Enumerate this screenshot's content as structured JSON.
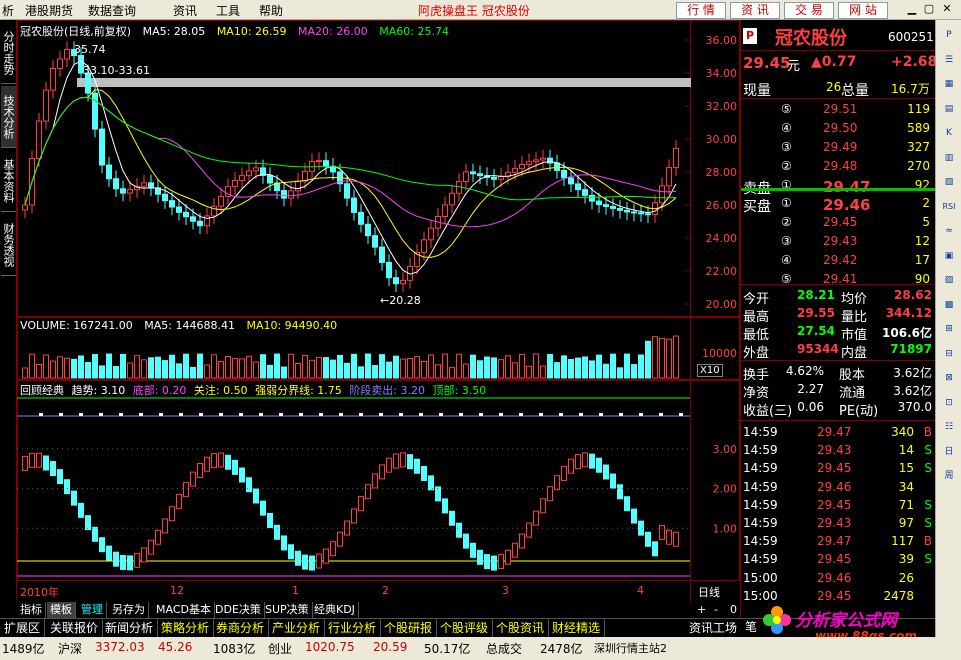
{
  "app": {
    "title": "阿虎操盘王  冠农股份",
    "menu": [
      "析",
      "港股期货",
      "数据查询",
      "资讯",
      "工具",
      "帮助"
    ],
    "menu_ids": [
      "analysis",
      "hk-futures",
      "data-query",
      "news",
      "tools",
      "help"
    ],
    "top_buttons": [
      "行 情",
      "资 讯",
      "交 易",
      "网 站"
    ],
    "top_button_ids": [
      "quotes",
      "news",
      "trade",
      "website"
    ]
  },
  "left_tabs": [
    "分时走势",
    "技术分析",
    "基本资料",
    "财务透视"
  ],
  "left_tab_ids": [
    "intraday",
    "technical",
    "fundamentals",
    "financial"
  ],
  "chart_info": {
    "title": "冠农股份(日线,前复权)",
    "ma5": "MA5: 28.05",
    "ma10": "MA10: 26.59",
    "ma20": "MA20: 26.00",
    "ma60": "MA60: 25.74",
    "hi_label": "35.74",
    "range_label": "33.10-33.61",
    "lo_label": "←20.28",
    "volume": "VOLUME: 167241.00",
    "vma5": "MA5: 144688.41",
    "vma10": "MA10: 94490.40",
    "indicator_name": "回顾经典",
    "trend": "趋势: 3.10",
    "bottom": "底部: 0.20",
    "focus": "关注: 0.50",
    "divide": "强弱分界线: 1.75",
    "stage_sell": "阶段卖出: 3.20",
    "top": "顶部: 3.50",
    "date_left": "2010年",
    "date_ticks": [
      "12",
      "1",
      "2",
      "3",
      "4"
    ],
    "period": "日线",
    "price_ticks": [
      "36.00",
      "34.00",
      "32.00",
      "30.00",
      "28.00",
      "26.00",
      "24.00",
      "22.00",
      "20.00"
    ],
    "vol_tick": "10000",
    "vol_mult": "X10",
    "ind_ticks": [
      "3.00",
      "2.00",
      "1.00"
    ],
    "colors": {
      "up": "#ff4040",
      "down": "#54ffff",
      "ma5": "#ffffff",
      "ma10": "#ffff00",
      "ma20": "#ff40ff",
      "ma60": "#00ff00"
    }
  },
  "bottom_tabs": [
    "指标",
    "模板",
    "管理",
    "另存为",
    "MACD基本",
    "DDE决策",
    "SUP决策",
    "经典KDJ"
  ],
  "bottom_tab_ids": [
    "indicator",
    "template",
    "manage",
    "save-as",
    "macd-basic",
    "dde",
    "sup",
    "classic-kdj"
  ],
  "bottom_tools": [
    "+",
    "-",
    "0"
  ],
  "toolbar2": [
    "扩展区",
    "关联报价",
    "新闻分析",
    "策略分析",
    "券商分析",
    "产业分析",
    "行业分析",
    "个股研报",
    "个股评级",
    "个股资讯",
    "财经精选"
  ],
  "toolbar2_ids": [
    "extension",
    "related-quotes",
    "news-analysis",
    "strategy",
    "broker",
    "industry-chain",
    "sector",
    "research",
    "rating",
    "stock-news",
    "finance-picks"
  ],
  "toolbar2_right": "资讯工场",
  "quote": {
    "name": "冠农股份",
    "code": "600251",
    "price": "29.45",
    "price_unit": "元",
    "change": "▲0.77",
    "change_pct": "+2.68",
    "cur_vol_label": "现量",
    "cur_vol": "26",
    "total_vol_label": "总量",
    "total_vol": "16.7万",
    "sell_label": "卖盘",
    "buy_label": "买盘",
    "sell": [
      {
        "lvl": "⑤",
        "price": "29.51",
        "vol": "119"
      },
      {
        "lvl": "④",
        "price": "29.50",
        "vol": "589"
      },
      {
        "lvl": "③",
        "price": "29.49",
        "vol": "327"
      },
      {
        "lvl": "②",
        "price": "29.48",
        "vol": "270"
      },
      {
        "lvl": "①",
        "price": "29.47",
        "vol": "92"
      }
    ],
    "buy": [
      {
        "lvl": "①",
        "price": "29.46",
        "vol": "2"
      },
      {
        "lvl": "②",
        "price": "29.45",
        "vol": "5"
      },
      {
        "lvl": "③",
        "price": "29.43",
        "vol": "12"
      },
      {
        "lvl": "④",
        "price": "29.42",
        "vol": "17"
      },
      {
        "lvl": "⑤",
        "price": "29.41",
        "vol": "90"
      }
    ],
    "stats": [
      {
        "l1": "今开",
        "v1": "28.21",
        "l2": "均价",
        "v2": "28.62"
      },
      {
        "l1": "最高",
        "v1": "29.55",
        "l2": "量比",
        "v2": "344.12"
      },
      {
        "l1": "最低",
        "v1": "27.54",
        "l2": "市值",
        "v2": "106.6亿"
      },
      {
        "l1": "外盘",
        "v1": "95344",
        "l2": "内盘",
        "v2": "71897"
      }
    ],
    "fundamentals": [
      {
        "l1": "换手",
        "v1": "4.62%",
        "l2": "股本",
        "v2": "3.62亿"
      },
      {
        "l1": "净资",
        "v1": "2.27",
        "l2": "流通",
        "v2": "3.62亿"
      },
      {
        "l1": "收益(三)",
        "v1": "0.06",
        "l2": "PE(动)",
        "v2": "370.0"
      }
    ],
    "ticks": [
      {
        "t": "14:59",
        "p": "29.47",
        "v": "340",
        "d": "B"
      },
      {
        "t": "14:59",
        "p": "29.43",
        "v": "14",
        "d": "S"
      },
      {
        "t": "14:59",
        "p": "29.45",
        "v": "15",
        "d": "S"
      },
      {
        "t": "14:59",
        "p": "29.46",
        "v": "34",
        "d": ""
      },
      {
        "t": "14:59",
        "p": "29.45",
        "v": "71",
        "d": "S"
      },
      {
        "t": "14:59",
        "p": "29.43",
        "v": "97",
        "d": "S"
      },
      {
        "t": "14:59",
        "p": "29.47",
        "v": "117",
        "d": "B"
      },
      {
        "t": "14:59",
        "p": "29.45",
        "v": "39",
        "d": "S"
      },
      {
        "t": "15:00",
        "p": "29.46",
        "v": "26",
        "d": ""
      },
      {
        "t": "15:00",
        "p": "29.45",
        "v": "2478",
        "d": ""
      }
    ],
    "tick_tab": "笔"
  },
  "right_toolbar": [
    "P",
    "☰",
    "▦",
    "▤",
    "K",
    "▥",
    "▧",
    "RSI",
    "≈",
    "▣",
    "▨",
    "▩",
    "⊞",
    "⊟",
    "⊠",
    "⊡",
    "☷",
    "日",
    "周"
  ],
  "statusbar": {
    "item1": "1489亿",
    "sz_label": "沪深",
    "sz_val": "3372.03",
    "sz_chg": "45.26",
    "item2": "1083亿",
    "cy_label": "创业",
    "cy_val": "1020.75",
    "cy_chg": "20.59",
    "item3": "50.17亿",
    "total_label": "总成交",
    "total_val": "2478亿",
    "site": "深圳行情主站2"
  },
  "logo": {
    "text": "分析家公式网",
    "url_text": "www.88gs.com"
  }
}
